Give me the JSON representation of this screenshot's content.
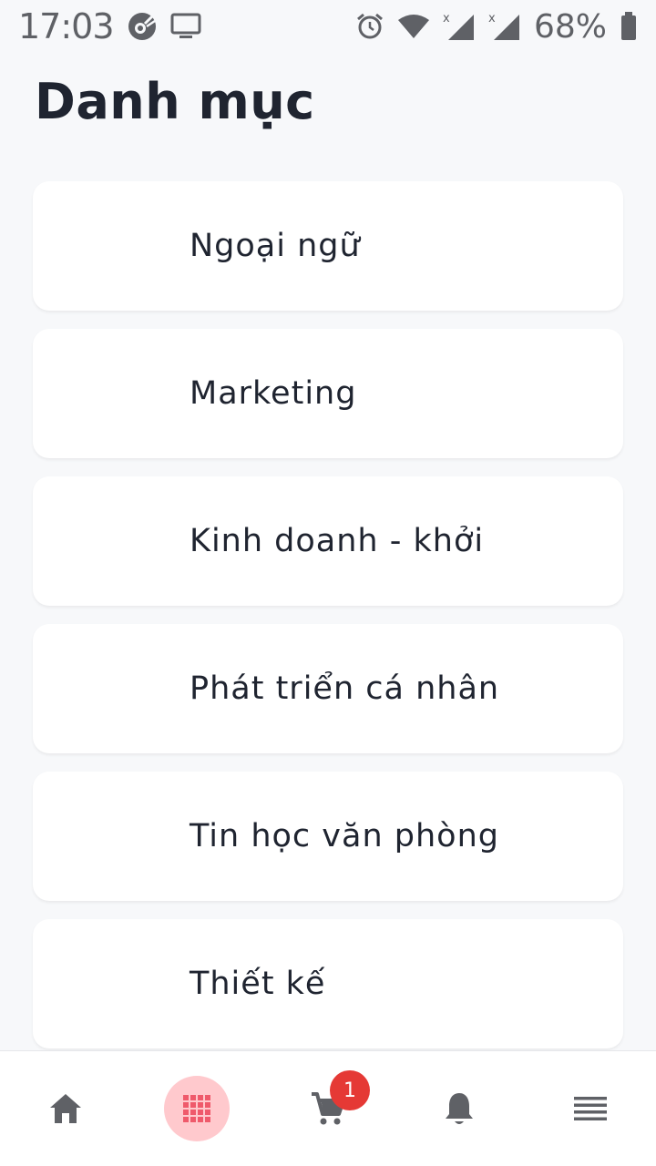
{
  "status_bar": {
    "time": "17:03",
    "battery_percent": "68%",
    "icons": [
      "app-icon",
      "screen-cast-icon",
      "alarm-icon",
      "wifi-icon",
      "signal-1-icon",
      "signal-2-icon",
      "battery-icon"
    ]
  },
  "page": {
    "title": "Danh mục"
  },
  "categories": [
    {
      "label": "Ngoại ngữ"
    },
    {
      "label": "Marketing"
    },
    {
      "label": "Kinh doanh - khởi"
    },
    {
      "label": "Phát triển cá nhân"
    },
    {
      "label": "Tin học văn phòng"
    },
    {
      "label": "Thiết kế"
    }
  ],
  "bottom_nav": {
    "items": [
      "home-icon",
      "grid-icon",
      "cart-icon",
      "bell-icon",
      "menu-icon"
    ],
    "active": "grid-icon",
    "cart_badge": "1"
  },
  "colors": {
    "background": "#f7f8fa",
    "card": "#ffffff",
    "text": "#1f2430",
    "active_nav_bg": "#ffc9cd",
    "active_nav_icon": "#ef5a6b",
    "badge": "#e53935",
    "icon_gray": "#5f6166"
  }
}
